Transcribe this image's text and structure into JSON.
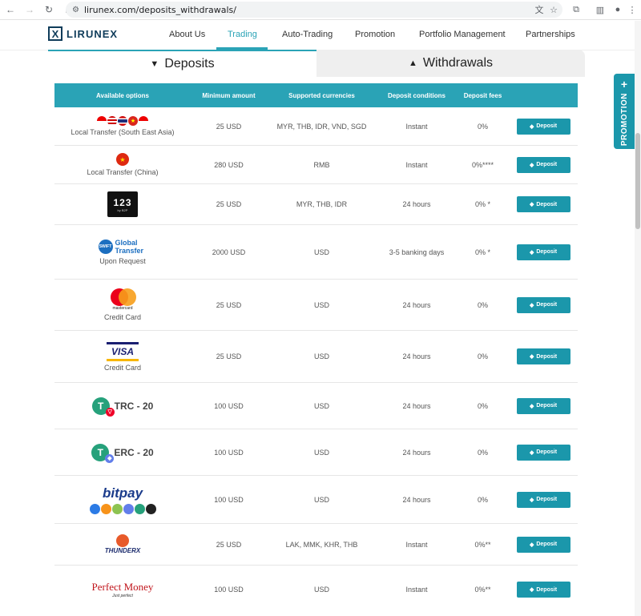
{
  "browser": {
    "url": "lirunex.com/deposits_withdrawals/"
  },
  "header": {
    "logo_text": "LIRUNEX",
    "menu": [
      "About Us",
      "Trading",
      "Auto-Trading",
      "Promotion",
      "Portfolio Management",
      "Partnerships"
    ],
    "active_menu": "Trading"
  },
  "tabs": {
    "deposits": "Deposits",
    "withdrawals": "Withdrawals"
  },
  "table": {
    "columns": [
      "Available options",
      "Minimum amount",
      "Supported currencies",
      "Deposit conditions",
      "Deposit fees"
    ],
    "button_label": "Deposit",
    "rows": [
      {
        "label": "Local Transfer (South East Asia)",
        "min": "25 USD",
        "currencies": "MYR, THB, IDR, VND, SGD",
        "conditions": "Instant",
        "fees": "0%"
      },
      {
        "label": "Local Transfer (China)",
        "min": "280 USD",
        "currencies": "RMB",
        "conditions": "Instant",
        "fees": "0%****"
      },
      {
        "label": "",
        "logo_text": "by B2P",
        "min": "25 USD",
        "currencies": "MYR, THB, IDR",
        "conditions": "24 hours",
        "fees": "0% *"
      },
      {
        "label": "Upon Request",
        "logo_text": "Global Transfer",
        "min": "2000 USD",
        "currencies": "USD",
        "conditions": "3-5 banking days",
        "fees": "0% *"
      },
      {
        "label": "Credit Card",
        "logo_text": "mastercard",
        "min": "25 USD",
        "currencies": "USD",
        "conditions": "24 hours",
        "fees": "0%"
      },
      {
        "label": "Credit Card",
        "logo_text": "VISA",
        "min": "25 USD",
        "currencies": "USD",
        "conditions": "24 hours",
        "fees": "0%"
      },
      {
        "label": "TRC - 20",
        "min": "100 USD",
        "currencies": "USD",
        "conditions": "24 hours",
        "fees": "0%"
      },
      {
        "label": "ERC - 20",
        "min": "100 USD",
        "currencies": "USD",
        "conditions": "24 hours",
        "fees": "0%"
      },
      {
        "label": "",
        "logo_text": "bitpay",
        "min": "100 USD",
        "currencies": "USD",
        "conditions": "24 hours",
        "fees": "0%"
      },
      {
        "label": "",
        "logo_text": "THUNDERX",
        "min": "25 USD",
        "currencies": "LAK, MMK, KHR, THB",
        "conditions": "Instant",
        "fees": "0%**"
      },
      {
        "label": "",
        "logo_text": "Perfect Money",
        "logo_sub": "Just perfect",
        "min": "100 USD",
        "currencies": "USD",
        "conditions": "Instant",
        "fees": "0%**"
      }
    ]
  },
  "promo": {
    "label": "PROMOTION",
    "plus": "+"
  },
  "colors": {
    "accent": "#2aa3b6",
    "button": "#1b97ab",
    "logo": "#0f3c5a"
  }
}
